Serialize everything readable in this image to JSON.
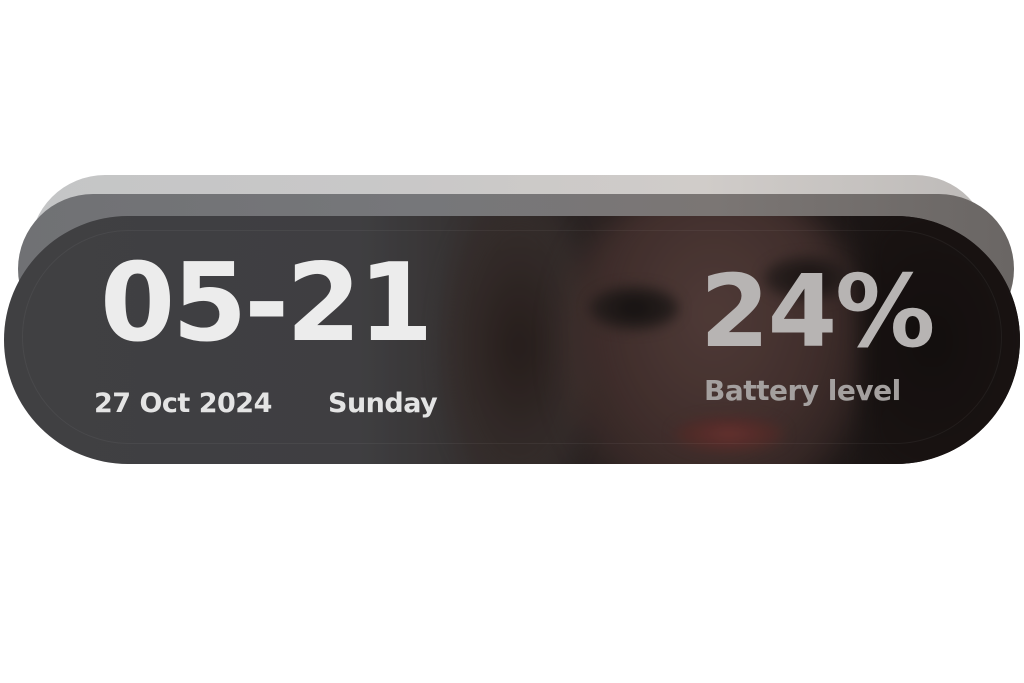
{
  "widget": {
    "time": "05-21",
    "date": "27 Oct 2024",
    "weekday": "Sunday",
    "battery_value": "24%",
    "battery_label": "Battery level",
    "battery_level_percent": 24
  },
  "colors": {
    "primary_text": "#ececec",
    "secondary_text": "#e4e4e4",
    "battery_text": "#b7b4b3",
    "battery_label": "#a4a09f",
    "panel_left": "#4a4b4e",
    "panel_right": "#1c1716",
    "rim_light": "#c4c5c6",
    "rim_dark": "#707174"
  }
}
